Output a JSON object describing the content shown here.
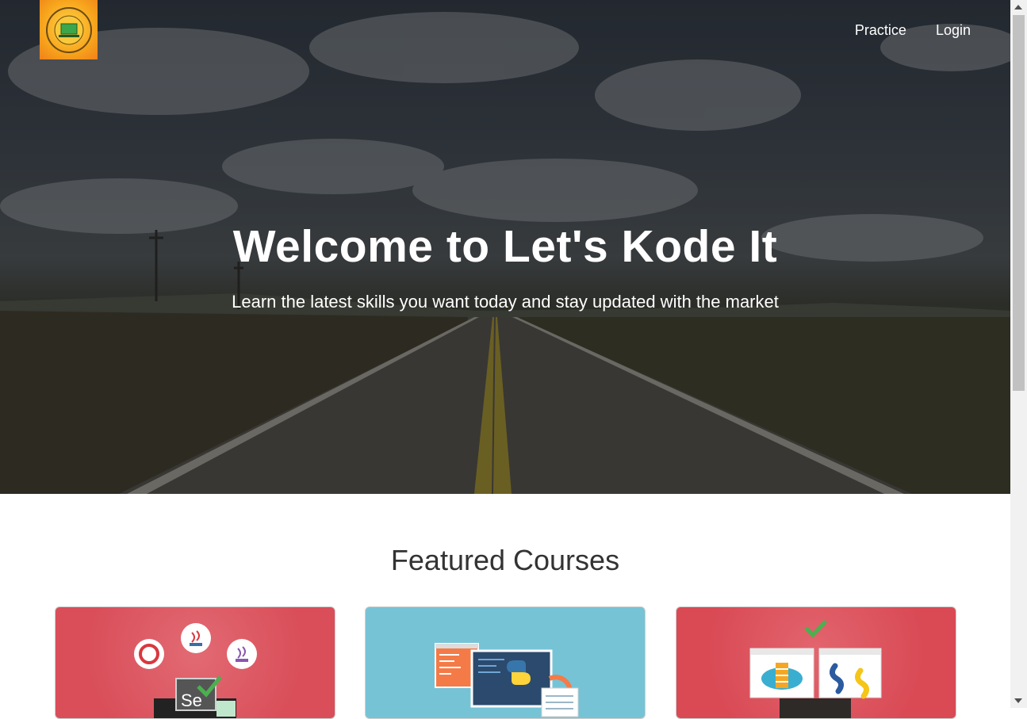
{
  "nav": {
    "items": [
      {
        "label": "Practice"
      },
      {
        "label": "Login"
      }
    ]
  },
  "hero": {
    "title": "Welcome to Let's Kode It",
    "subtitle": "Learn the latest skills you want today and stay updated with the market"
  },
  "featured": {
    "title": "Featured Courses"
  },
  "logo": {
    "ring_text": "Let's Kode It",
    "bottom_text": "Anyone Can Code"
  },
  "colors": {
    "card_red": "#d94e59",
    "card_blue": "#76c3d6",
    "check_green": "#5cb85c"
  },
  "icons": [
    "site-logo",
    "road-landscape",
    "selenium-java-icon",
    "python-code-icon",
    "python-servers-icon"
  ]
}
